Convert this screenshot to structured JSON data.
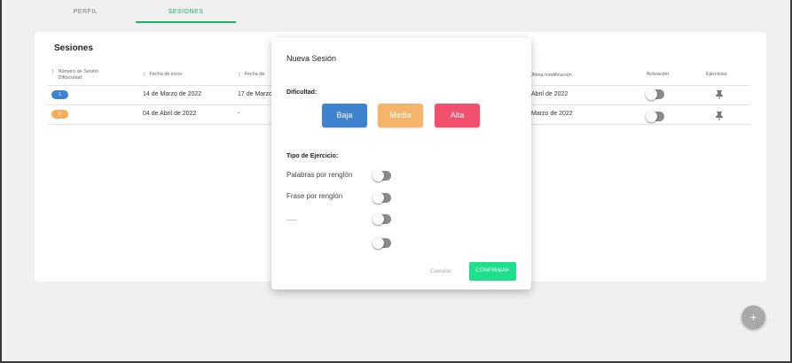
{
  "tabs": [
    {
      "label": "PERFIL"
    },
    {
      "label": "SESIONES"
    }
  ],
  "sessions": {
    "title": "Sesiones",
    "columns": {
      "difficulty": "Número de Sesión Dificicultad",
      "start_date": "Fecha de inicio",
      "end_date": "Fecha de",
      "last_modified": "Última modificación",
      "activation": "Activación",
      "exercises": "Ejercicios"
    },
    "rows": [
      {
        "badge": "1",
        "badge_color": "#3b82d1",
        "start": "14 de Marzo de 2022",
        "end": "17 de Marzo",
        "modified": "Abril de 2022"
      },
      {
        "badge": "2",
        "badge_color": "#f5ad62",
        "start": "04 de Abril de 2022",
        "end": "-",
        "modified": "Marzo de 2022"
      }
    ]
  },
  "modal": {
    "title": "Nueva Sesión",
    "difficulty_label": "Dificultad:",
    "difficulty_options": [
      {
        "label": "Baja",
        "color": "#3f82cf"
      },
      {
        "label": "Media",
        "color": "#f6b46a"
      },
      {
        "label": "Alta",
        "color": "#f24f6e"
      }
    ],
    "exercise_type_label": "Tipo de Ejercicio:",
    "exercise_options": [
      {
        "label": "Palabras por renglón"
      },
      {
        "label": "Frase por renglón"
      }
    ],
    "cancel_label": "Cancelar",
    "confirm_label": "CONFIRMAR"
  },
  "fab": {
    "icon": "plus-icon",
    "symbol": "+"
  },
  "colors": {
    "accent": "#1db06a",
    "confirm": "#1de08a",
    "toggle_off": "#8a8a8a"
  }
}
